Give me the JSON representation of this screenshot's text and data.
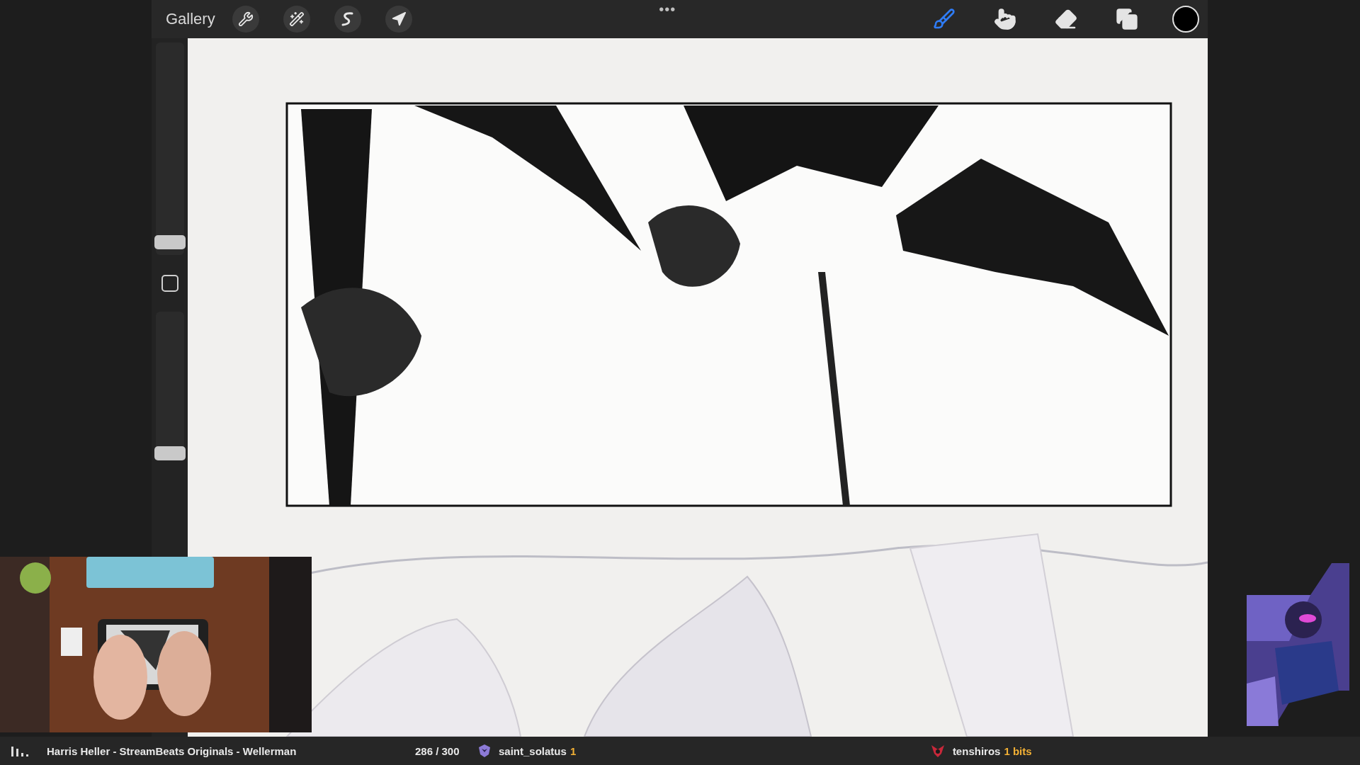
{
  "toolbar": {
    "gallery": "Gallery",
    "menu": "•••",
    "left_tools": [
      {
        "kind": "wrench",
        "selected": false
      },
      {
        "kind": "wand",
        "selected": false
      },
      {
        "kind": "selection",
        "selected": false
      },
      {
        "kind": "arrow",
        "selected": false
      }
    ],
    "right_tools": [
      {
        "kind": "brush",
        "selected": true
      },
      {
        "kind": "smudge",
        "selected": false
      },
      {
        "kind": "eraser",
        "selected": false
      },
      {
        "kind": "layers",
        "selected": false
      }
    ],
    "color": "#000000"
  },
  "sidebar": {
    "size_slider": {
      "level": 0.03
    },
    "opacity_slider": {
      "level": 0.0
    }
  },
  "stream_bar": {
    "song": "Harris Heller - StreamBeats Originals - Wellerman",
    "goal": "286 / 300",
    "subscriber": {
      "name": "saint_solatus",
      "count": "1"
    },
    "cheer": {
      "name": "tenshiros",
      "amount": "1 bits"
    }
  }
}
